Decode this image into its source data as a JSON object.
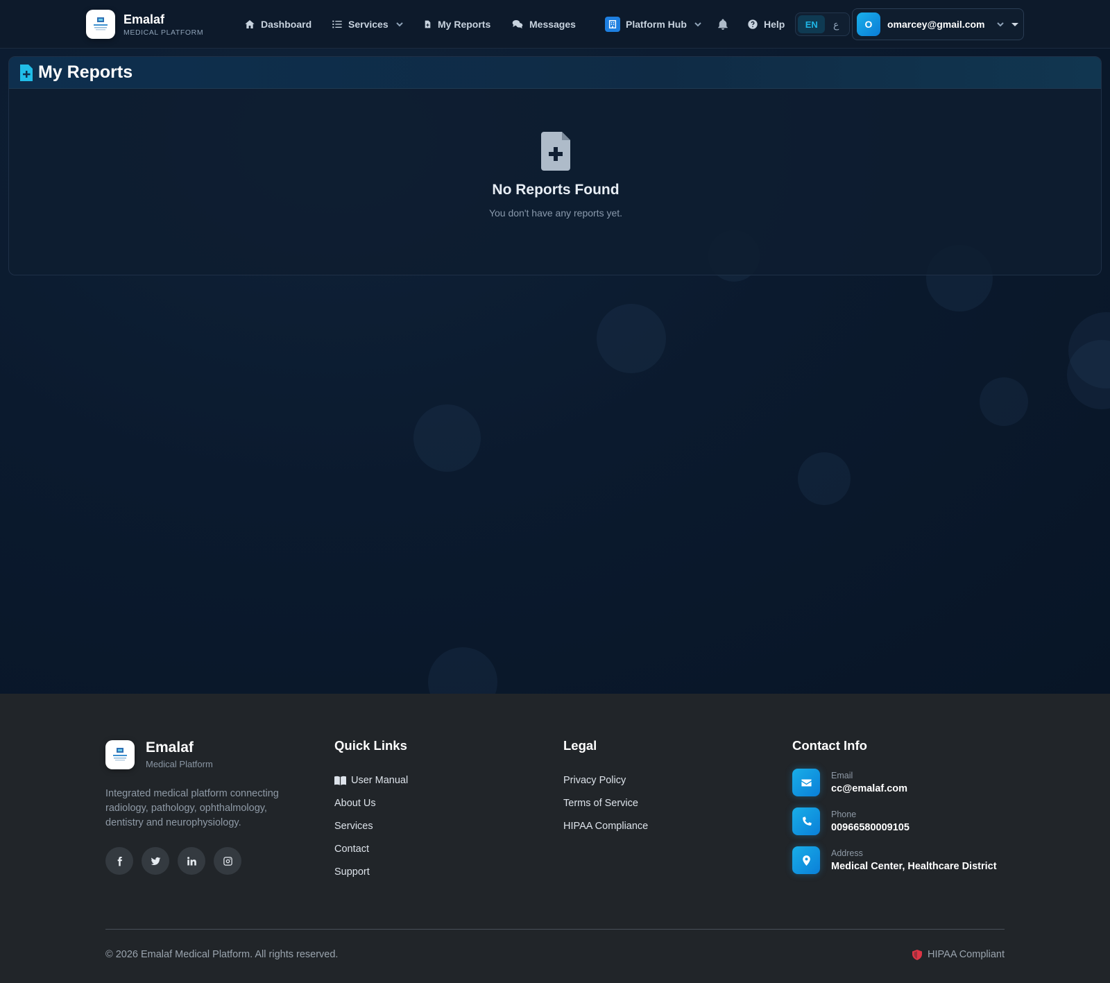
{
  "brand": {
    "name": "Emalaf",
    "subtitle": "MEDICAL PLATFORM"
  },
  "nav": {
    "dashboard": "Dashboard",
    "services": "Services",
    "my_reports": "My Reports",
    "messages": "Messages",
    "platform_hub": "Platform Hub",
    "help": "Help"
  },
  "language": {
    "en": "EN",
    "ar": "ع"
  },
  "user": {
    "initial": "O",
    "email": "omarcey@gmail.com"
  },
  "page": {
    "title": "My Reports",
    "empty_title": "No Reports Found",
    "empty_subtitle": "You don't have any reports yet."
  },
  "footer": {
    "brand_name": "Emalaf",
    "brand_subtitle": "Medical Platform",
    "description": "Integrated medical platform connecting radiology, pathology, ophthalmology, dentistry and neurophysiology.",
    "socials": [
      "facebook-icon",
      "twitter-icon",
      "linkedin-icon",
      "instagram-icon"
    ],
    "quick_links": {
      "title": "Quick Links",
      "items": [
        "User Manual",
        "About Us",
        "Services",
        "Contact",
        "Support"
      ]
    },
    "legal": {
      "title": "Legal",
      "items": [
        "Privacy Policy",
        "Terms of Service",
        "HIPAA Compliance"
      ]
    },
    "contact": {
      "title": "Contact Info",
      "email_label": "Email",
      "email": "cc@emalaf.com",
      "phone_label": "Phone",
      "phone": "00966580009105",
      "address_label": "Address",
      "address": "Medical Center, Healthcare District"
    },
    "copyright": "© 2026 Emalaf Medical Platform. All rights reserved.",
    "hipaa": "HIPAA Compliant"
  },
  "colors": {
    "accent": "#1ab0ea",
    "background": "#0a1628",
    "footer": "#212529",
    "hipaa_shield": "#dc3545"
  }
}
